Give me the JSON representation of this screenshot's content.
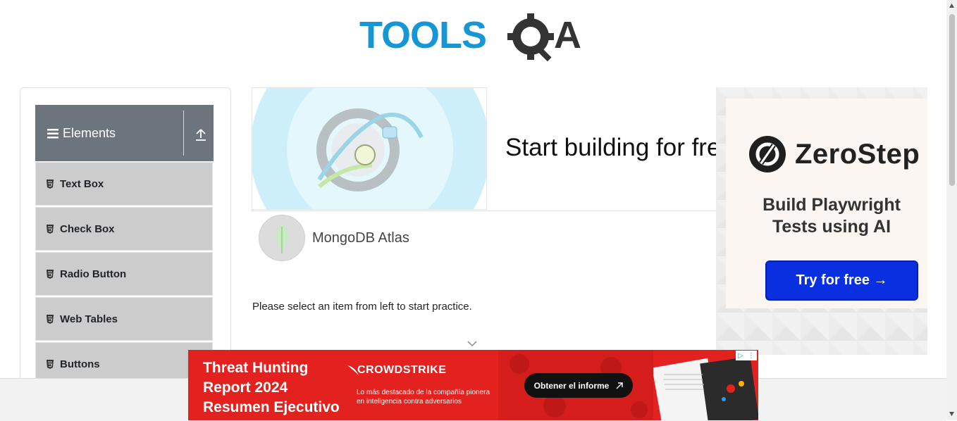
{
  "header": {
    "logo_text": "TOOLSQA",
    "logo_primary": "#1597d6",
    "logo_secondary": "#333333"
  },
  "sidebar": {
    "group_title": "Elements",
    "group_icon": "hamburger-icon",
    "collapse_icon": "collapse-arrow-icon",
    "items": [
      {
        "label": "Text Box",
        "icon": "html5-icon"
      },
      {
        "label": "Check Box",
        "icon": "html5-icon"
      },
      {
        "label": "Radio Button",
        "icon": "html5-icon"
      },
      {
        "label": "Web Tables",
        "icon": "html5-icon"
      },
      {
        "label": "Buttons",
        "icon": "html5-icon"
      }
    ]
  },
  "banner_ad": {
    "title": "Start building for free",
    "advertiser": "MongoDB Atlas"
  },
  "main": {
    "prompt": "Please select an item from left to start practice."
  },
  "side_ad": {
    "brand": "ZeroStep",
    "tagline_line1": "Build Playwright",
    "tagline_line2": "Tests using AI",
    "cta": "Try for free →",
    "adchoice": "⋮"
  },
  "bottom_ad": {
    "title_line1": "Threat Hunting",
    "title_line2": "Report 2024",
    "title_line3": "Resumen Ejecutivo",
    "brand": "CROWDSTRIKE",
    "desc": "Lo más destacado de la compañía pionera en inteligencia contra adversarios",
    "cta": "Obtener el informe",
    "accent": "#e3211f"
  }
}
